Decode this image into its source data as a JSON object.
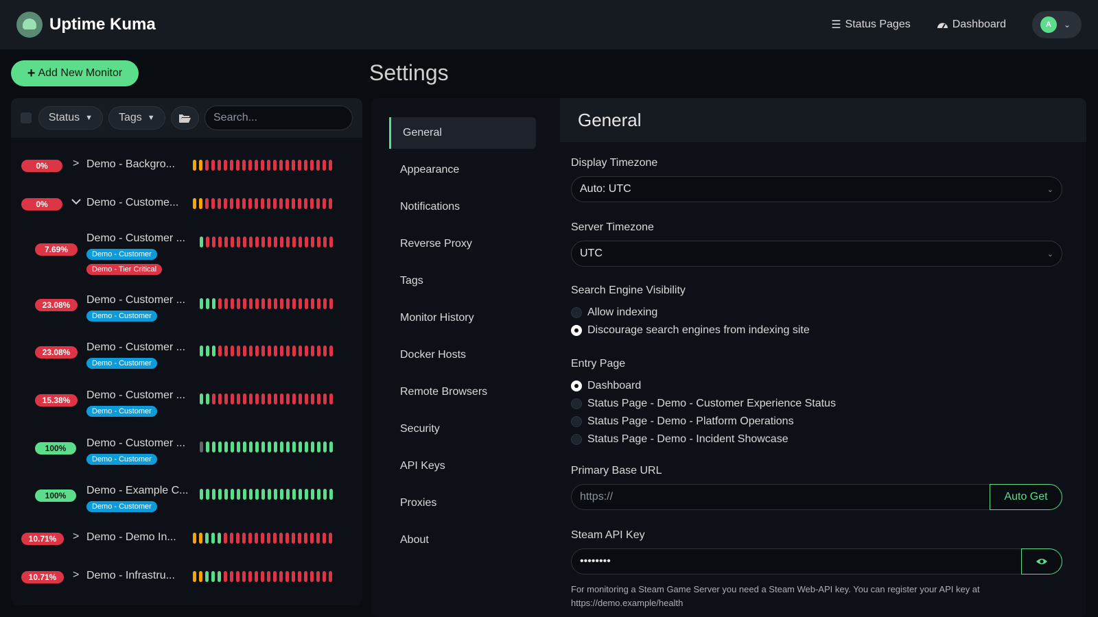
{
  "header": {
    "brand": "Uptime Kuma",
    "status_pages": "Status Pages",
    "dashboard": "Dashboard",
    "avatar_initial": "A"
  },
  "sidebar": {
    "add_button": "Add New Monitor",
    "filter_status": "Status",
    "filter_tags": "Tags",
    "search_placeholder": "Search...",
    "monitors": [
      {
        "pct": "0%",
        "name": "Demo - Backgro...",
        "arrow": "›",
        "tags": []
      },
      {
        "pct": "0%",
        "name": "Demo - Custome...",
        "arrow": "⌄",
        "tags": []
      },
      {
        "pct": "7.69%",
        "name": "Demo - Customer ...",
        "tags": [
          "Demo - Customer",
          "Demo - Tier Critical"
        ]
      },
      {
        "pct": "23.08%",
        "name": "Demo - Customer ...",
        "tags": [
          "Demo - Customer"
        ]
      },
      {
        "pct": "23.08%",
        "name": "Demo - Customer ...",
        "tags": [
          "Demo - Customer"
        ]
      },
      {
        "pct": "15.38%",
        "name": "Demo - Customer ...",
        "tags": [
          "Demo - Customer"
        ]
      },
      {
        "pct": "100%",
        "name": "Demo - Customer ...",
        "tags": [
          "Demo - Customer"
        ]
      },
      {
        "pct": "100%",
        "name": "Demo - Example C...",
        "tags": [
          "Demo - Customer"
        ]
      },
      {
        "pct": "10.71%",
        "name": "Demo - Demo In...",
        "arrow": "›",
        "tags": []
      },
      {
        "pct": "10.71%",
        "name": "Demo - Infrastru...",
        "arrow": "›",
        "tags": []
      }
    ]
  },
  "settings": {
    "title": "Settings",
    "menu": [
      "General",
      "Appearance",
      "Notifications",
      "Reverse Proxy",
      "Tags",
      "Monitor History",
      "Docker Hosts",
      "Remote Browsers",
      "Security",
      "API Keys",
      "Proxies",
      "About"
    ],
    "section_title": "General",
    "display_timezone_label": "Display Timezone",
    "display_timezone_value": "Auto: UTC",
    "server_timezone_label": "Server Timezone",
    "server_timezone_value": "UTC",
    "search_visibility_label": "Search Engine Visibility",
    "allow_indexing": "Allow indexing",
    "discourage_indexing": "Discourage search engines from indexing site",
    "entry_page_label": "Entry Page",
    "entry_options": [
      "Dashboard",
      "Status Page - Demo - Customer Experience Status",
      "Status Page - Demo - Platform Operations",
      "Status Page - Demo - Incident Showcase"
    ],
    "base_url_label": "Primary Base URL",
    "base_url_placeholder": "https://",
    "auto_get": "Auto Get",
    "steam_label": "Steam API Key",
    "steam_value": "••••••••",
    "steam_help": "For monitoring a Steam Game Server you need a Steam Web-API key. You can register your API key at",
    "steam_help_link": "https://demo.example/health"
  }
}
